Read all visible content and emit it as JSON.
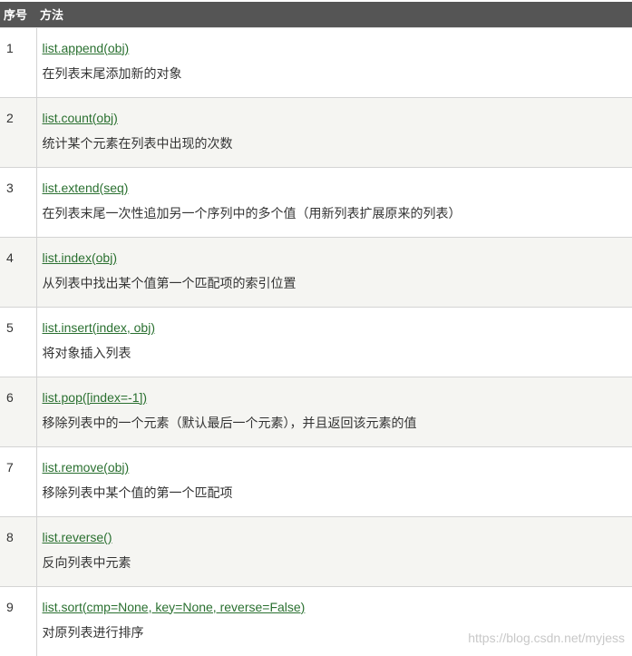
{
  "table": {
    "header": {
      "num": "序号",
      "method": "方法"
    },
    "rows": [
      {
        "num": "1",
        "method": "list.append(obj)",
        "desc": "在列表末尾添加新的对象"
      },
      {
        "num": "2",
        "method": "list.count(obj)",
        "desc": "统计某个元素在列表中出现的次数"
      },
      {
        "num": "3",
        "method": "list.extend(seq)",
        "desc": "在列表末尾一次性追加另一个序列中的多个值（用新列表扩展原来的列表）"
      },
      {
        "num": "4",
        "method": "list.index(obj)",
        "desc": "从列表中找出某个值第一个匹配项的索引位置"
      },
      {
        "num": "5",
        "method": "list.insert(index, obj)",
        "desc": "将对象插入列表"
      },
      {
        "num": "6",
        "method": "list.pop([index=-1])",
        "desc": "移除列表中的一个元素（默认最后一个元素），并且返回该元素的值"
      },
      {
        "num": "7",
        "method": "list.remove(obj)",
        "desc": "移除列表中某个值的第一个匹配项"
      },
      {
        "num": "8",
        "method": "list.reverse()",
        "desc": "反向列表中元素"
      },
      {
        "num": "9",
        "method": "list.sort(cmp=None, key=None, reverse=False)",
        "desc": "对原列表进行排序"
      }
    ]
  },
  "watermark": "https://blog.csdn.net/myjess",
  "colors": {
    "header_bg": "#555555",
    "link": "#2a7030",
    "stripe": "#f5f5f2"
  }
}
